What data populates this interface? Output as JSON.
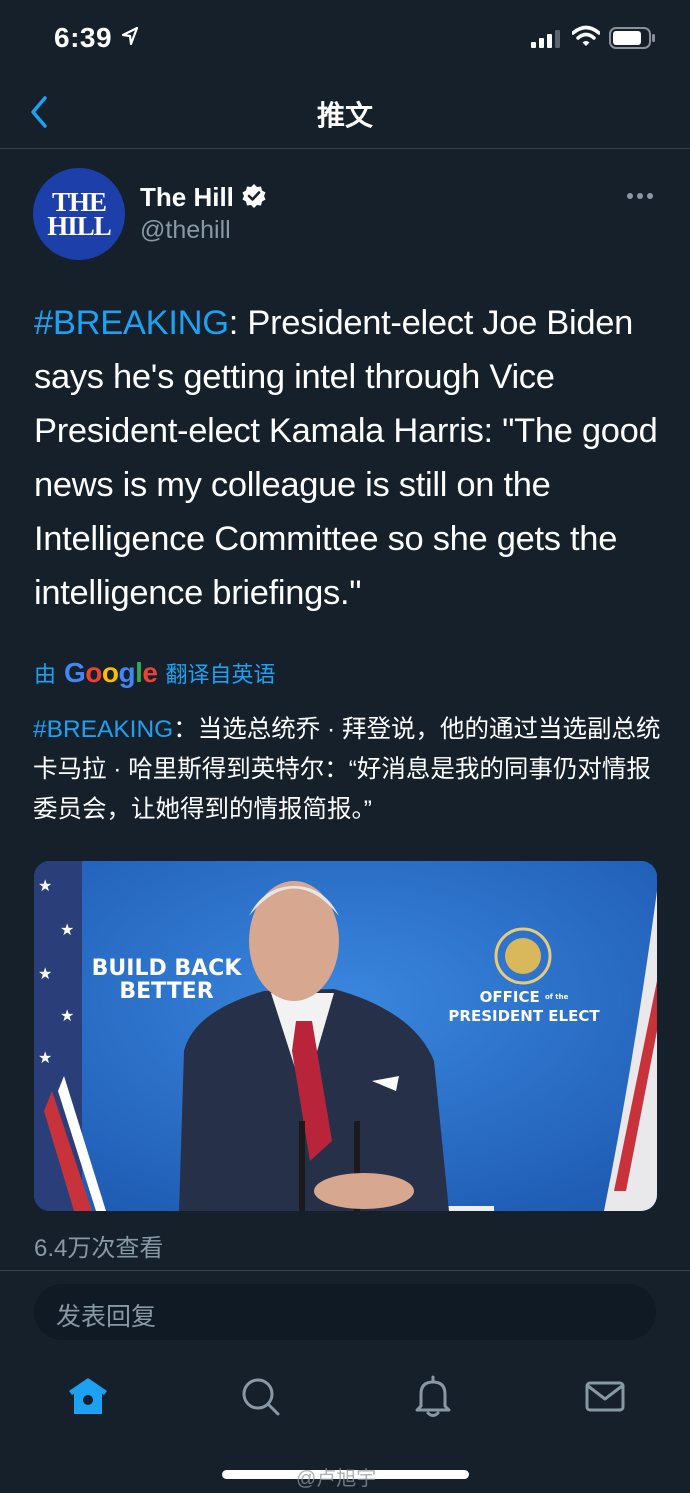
{
  "status_bar": {
    "time": "6:39"
  },
  "nav": {
    "title": "推文"
  },
  "author": {
    "avatar_text_line1": "THE",
    "avatar_text_line2": "HILL",
    "name": "The Hill",
    "handle": "@thehill"
  },
  "tweet": {
    "hashtag": "#BREAKING",
    "text": ": President-elect Joe Biden says he's getting intel through Vice President-elect Kamala Harris: \"The good news is my colleague is still on the Intelligence Committee so she gets the intelligence briefings.\""
  },
  "translation": {
    "prefix": "由",
    "provider": "Google",
    "suffix": "翻译自英语",
    "hashtag": "#BREAKING",
    "text": "：当选总统乔 · 拜登说，他的通过当选副总统卡马拉 · 哈里斯得到英特尔：“好消息是我的同事仍对情报委员会，让她得到的情报简报。”"
  },
  "media": {
    "left_sign_line1": "BUILD BACK",
    "left_sign_line2": "BETTER",
    "right_sign_line1": "OFFICE",
    "right_sign_small": "of the",
    "right_sign_line2": "PRESIDENT ELECT"
  },
  "stats": {
    "views": "6.4万次查看"
  },
  "reply": {
    "placeholder": "发表回复"
  },
  "tabbar": {
    "items": [
      "home-icon",
      "search-icon",
      "notifications-icon",
      "messages-icon"
    ]
  },
  "watermark": "@卢旭宇",
  "colors": {
    "background": "#15202b",
    "accent": "#1da1f2",
    "muted": "#8899a6",
    "divider": "#38444d"
  }
}
